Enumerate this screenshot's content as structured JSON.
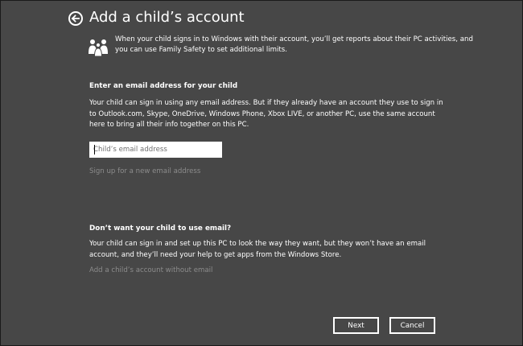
{
  "header": {
    "title": "Add a child’s account",
    "back_icon": "back-arrow-icon"
  },
  "intro": {
    "icon": "family-icon",
    "text": "When your child signs in to Windows with their account, you’ll get reports about their PC activities, and you can use Family Safety to set additional limits."
  },
  "email_section": {
    "heading": "Enter an email address for your child",
    "description": "Your child can sign in using any email address. But if they already have an account they use to sign in to Outlook.com, Skype, OneDrive, Windows Phone, Xbox LIVE, or another PC, use the same account here to bring all their info together on this PC.",
    "input": {
      "placeholder": "Child’s email address",
      "value": ""
    },
    "signup_link": "Sign up for a new email address"
  },
  "no_email_section": {
    "heading": "Don’t want your child to use email?",
    "description": "Your child can sign in and set up this PC to look the way they want, but they won’t have an email account, and they’ll need your help to get apps from the Windows Store.",
    "link": "Add a child’s account without email"
  },
  "buttons": {
    "next": "Next",
    "cancel": "Cancel"
  },
  "colors": {
    "background": "#474747",
    "text": "#ffffff",
    "link": "#8c8c8c"
  }
}
